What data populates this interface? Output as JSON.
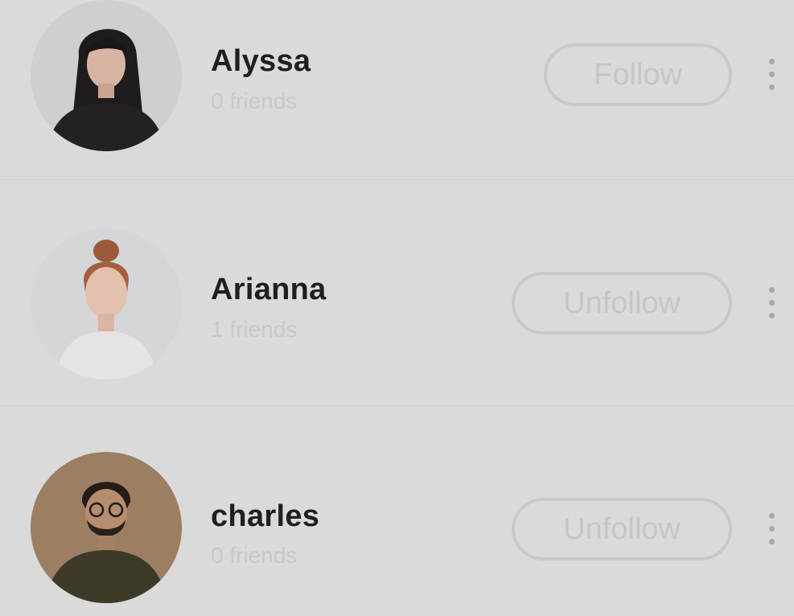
{
  "users": [
    {
      "name": "Alyssa",
      "friends": "0 friends",
      "button_label": "Follow",
      "avatar_icon": "avatar-woman-dark-hair"
    },
    {
      "name": "Arianna",
      "friends": "1 friends",
      "button_label": "Unfollow",
      "avatar_icon": "avatar-woman-bun"
    },
    {
      "name": "charles",
      "friends": "0 friends",
      "button_label": "Unfollow",
      "avatar_icon": "avatar-man-beard"
    }
  ],
  "colors": {
    "background": "#dadada",
    "name_text": "#1f1f1f",
    "subtitle_text": "#c9c9c9",
    "button_border": "#c9c9c9"
  }
}
